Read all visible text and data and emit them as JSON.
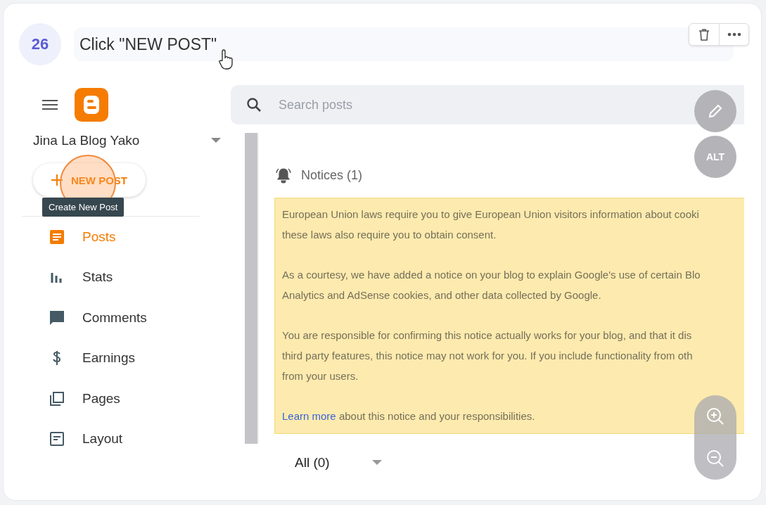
{
  "step": {
    "number": "26",
    "title": "Click \"NEW POST\""
  },
  "sidebar": {
    "blog_name": "Jina La Blog Yako",
    "new_post": "NEW POST",
    "tooltip": "Create New Post",
    "items": [
      {
        "label": "Posts",
        "kind": "posts",
        "selected": true
      },
      {
        "label": "Stats",
        "kind": "stats",
        "selected": false
      },
      {
        "label": "Comments",
        "kind": "comments",
        "selected": false
      },
      {
        "label": "Earnings",
        "kind": "earnings",
        "selected": false
      },
      {
        "label": "Pages",
        "kind": "pages",
        "selected": false
      },
      {
        "label": "Layout",
        "kind": "layout",
        "selected": false
      }
    ]
  },
  "search": {
    "placeholder": "Search posts"
  },
  "floating": {
    "alt": "ALT"
  },
  "notices": {
    "title": "Notices (1)",
    "paragraphs": [
      [
        "European Union laws require you to give European Union visitors information about cooki",
        "these laws also require you to obtain consent."
      ],
      [
        "As a courtesy, we have added a notice on your blog to explain Google's use of certain Blo",
        "Analytics and AdSense cookies, and other data collected by Google."
      ],
      [
        "You are responsible for confirming this notice actually works for your blog, and that it dis",
        "third party features, this notice may not work for you. If you include functionality from oth",
        "from your users."
      ]
    ],
    "link": "Learn more",
    "link_rest": "about this notice and your responsibilities."
  },
  "filter": {
    "value": "All (0)"
  }
}
